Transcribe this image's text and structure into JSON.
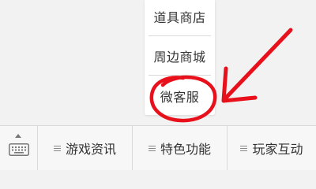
{
  "popup_menu": {
    "items": [
      {
        "label": "道具商店"
      },
      {
        "label": "周边商城"
      },
      {
        "label": "微客服"
      }
    ]
  },
  "bottom_menu": {
    "items": [
      {
        "label": "游戏资讯",
        "icon": "menu-lines-icon"
      },
      {
        "label": "特色功能",
        "icon": "menu-lines-icon"
      },
      {
        "label": "玩家互动",
        "icon": "menu-lines-icon"
      }
    ],
    "keyboard_icon": "keyboard-icon"
  },
  "annotation": {
    "color": "#e8101a",
    "shapes": [
      "circle-highlight",
      "pointer-arrow"
    ]
  }
}
